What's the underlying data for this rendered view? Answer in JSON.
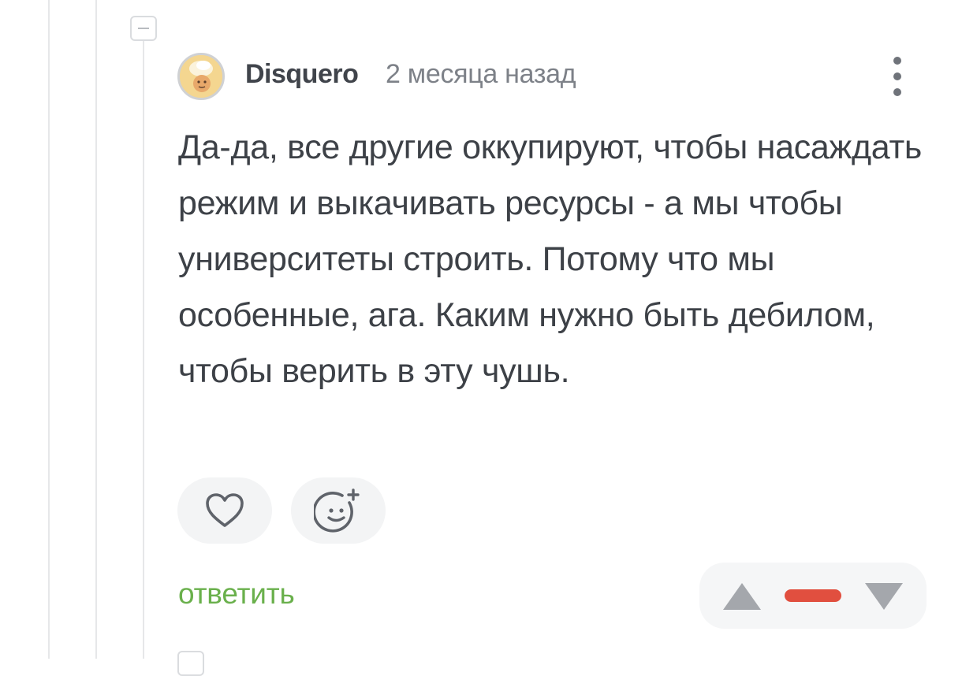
{
  "comment": {
    "author": "Disquero",
    "timestamp": "2 месяца назад",
    "text": "Да-да, все другие оккупируют, чтобы насаждать режим и выкачивать ресурсы - а мы чтобы университеты строить. Потому что мы особенные, ага. Каким нужно быть дебилом, чтобы верить в эту чушь.",
    "reply_label": "ответить",
    "rating_state": "negative"
  },
  "icons": {
    "collapse": "minus-box-icon",
    "more": "vertical-dots-icon",
    "like": "heart-icon",
    "react": "smiley-plus-icon",
    "vote_up": "triangle-up-icon",
    "vote_down": "triangle-down-icon"
  },
  "colors": {
    "reply_link": "#6ab04c",
    "negative_rating": "#e14f3f",
    "text": "#3d4147",
    "muted": "#7d8188"
  }
}
